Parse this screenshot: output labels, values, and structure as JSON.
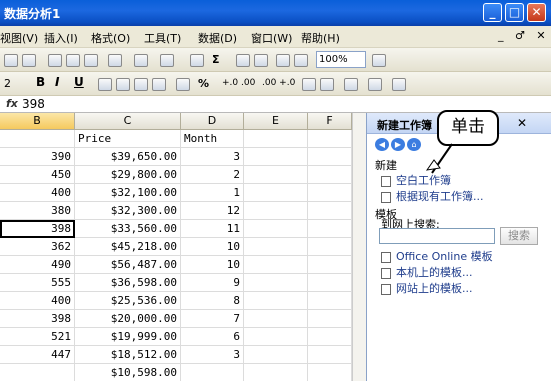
{
  "window": {
    "title": "数据分析1",
    "min_glyph": "_",
    "max_glyph": "□",
    "close_glyph": "✕"
  },
  "menu": {
    "items": [
      "视图(V)",
      "插入(I)",
      "格式(O)",
      "工具(T)",
      "数据(D)",
      "窗口(W)",
      "帮助(H)"
    ],
    "right_controls": "_ ♂ ✕"
  },
  "toolbar": {
    "zoom": "100%",
    "autosum": "Σ",
    "font_size": "2",
    "bold": "B",
    "italic": "I",
    "underline": "U",
    "percent": "%",
    "dec_inc": "+.0 .00",
    "dec_dec": ".00 +.0"
  },
  "formula_bar": {
    "fx": "fx",
    "value": "398"
  },
  "grid": {
    "columns": [
      "B",
      "C",
      "D",
      "E",
      "F"
    ],
    "rows": [
      [
        "",
        "Price",
        "Month",
        "",
        ""
      ],
      [
        "390",
        "$39,650.00",
        "3",
        "",
        ""
      ],
      [
        "450",
        "$29,800.00",
        "2",
        "",
        ""
      ],
      [
        "400",
        "$32,100.00",
        "1",
        "",
        ""
      ],
      [
        "380",
        "$32,300.00",
        "12",
        "",
        ""
      ],
      [
        "398",
        "$33,560.00",
        "11",
        "",
        ""
      ],
      [
        "362",
        "$45,218.00",
        "10",
        "",
        ""
      ],
      [
        "490",
        "$56,487.00",
        "10",
        "",
        ""
      ],
      [
        "555",
        "$36,598.00",
        "9",
        "",
        ""
      ],
      [
        "400",
        "$25,536.00",
        "8",
        "",
        ""
      ],
      [
        "398",
        "$20,000.00",
        "7",
        "",
        ""
      ],
      [
        "521",
        "$19,999.00",
        "6",
        "",
        ""
      ],
      [
        "447",
        "$18,512.00",
        "3",
        "",
        ""
      ],
      [
        "",
        "$10,598.00",
        "",
        "",
        ""
      ],
      [
        "",
        "",
        "",
        "",
        ""
      ]
    ]
  },
  "task_pane": {
    "title": "新建工作簿",
    "close": "✕",
    "new_section": "新建",
    "blank_workbook": "空白工作簿",
    "from_existing": "根据现有工作簿...",
    "templates_section": "模板",
    "search_online": "到网上搜索:",
    "search_button": "搜索",
    "office_online": "Office Online 模板",
    "on_computer": "本机上的模板...",
    "on_websites": "网站上的模板..."
  },
  "callout": {
    "text": "单击"
  }
}
